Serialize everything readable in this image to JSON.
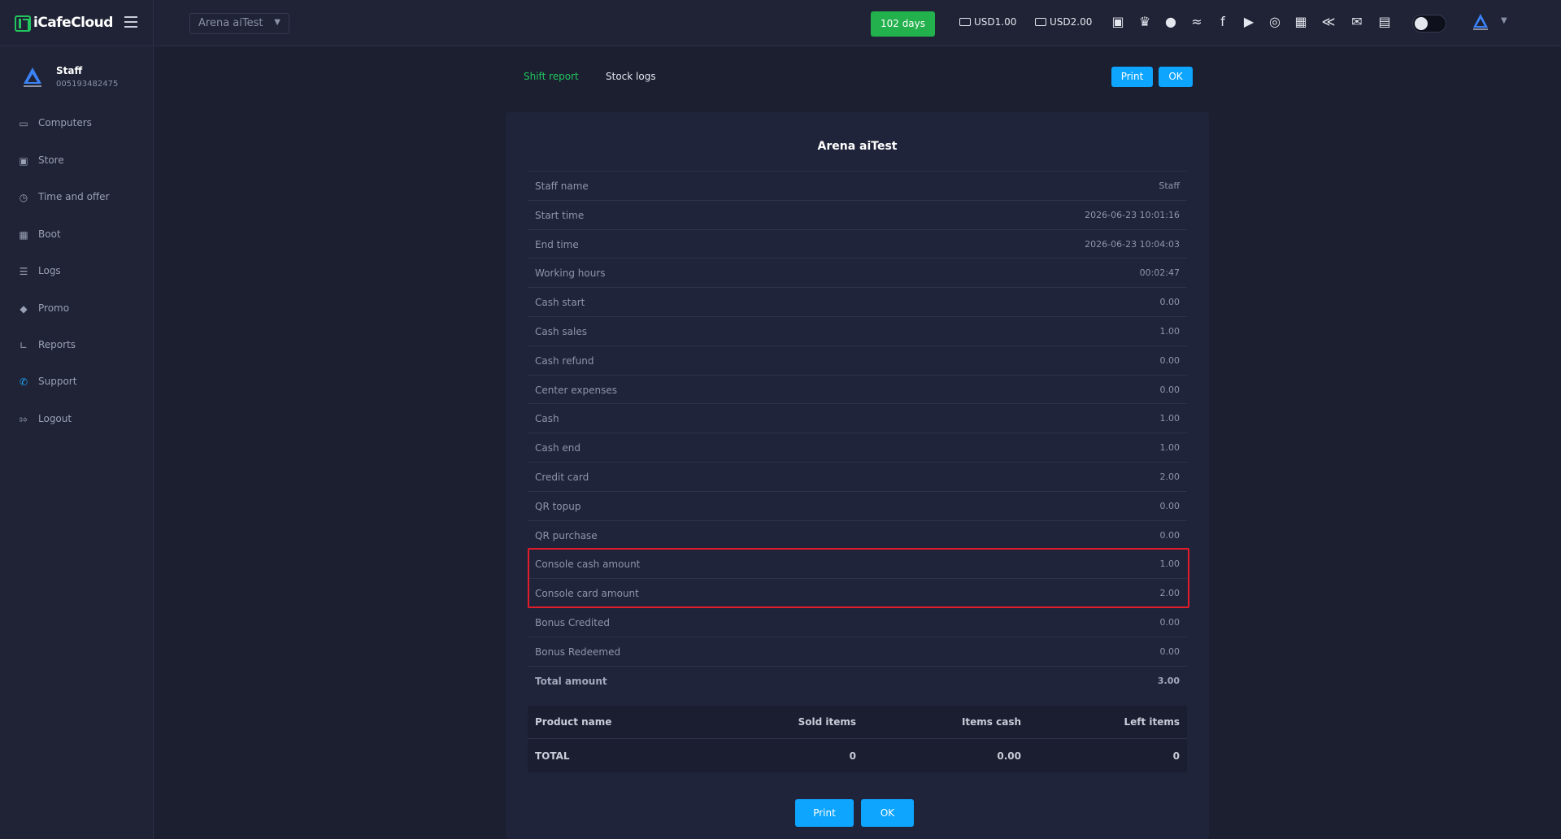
{
  "app": {
    "brand": "iCafeCloud",
    "center": "Arena aiTest",
    "days_left": "102 days",
    "balance_cash": "USD1.00",
    "balance_card": "USD2.00"
  },
  "colors": {
    "accent_green": "#22c55e",
    "button_blue": "#0ea5ff",
    "highlight_red": "#e11d2a",
    "background": "#1b1f30"
  },
  "top_icons": [
    "ranking-icon",
    "trophy-icon",
    "community-icon",
    "rss-icon",
    "facebook-icon",
    "youtube-icon",
    "globe-icon",
    "icafe-icon",
    "handshake-icon",
    "mail-icon",
    "chat-icon"
  ],
  "user": {
    "name": "Staff",
    "id": "005193482475"
  },
  "sidebar": {
    "items": [
      {
        "label": "Computers",
        "icon": "monitor-icon"
      },
      {
        "label": "Store",
        "icon": "bag-icon"
      },
      {
        "label": "Time and offer",
        "icon": "clock-icon"
      },
      {
        "label": "Boot",
        "icon": "windows-icon"
      },
      {
        "label": "Logs",
        "icon": "list-icon"
      },
      {
        "label": "Promo",
        "icon": "tag-icon"
      },
      {
        "label": "Reports",
        "icon": "chart-icon"
      },
      {
        "label": "Support",
        "icon": "phone-icon"
      },
      {
        "label": "Logout",
        "icon": "logout-icon"
      }
    ]
  },
  "tabs": {
    "shift_report": "Shift report",
    "stock_logs": "Stock logs"
  },
  "actions": {
    "print": "Print",
    "ok": "OK"
  },
  "report": {
    "title": "Arena aiTest",
    "rows": [
      {
        "label": "Staff name",
        "value": "Staff"
      },
      {
        "label": "Start time",
        "value": "2026-06-23 10:01:16"
      },
      {
        "label": "End time",
        "value": "2026-06-23 10:04:03"
      },
      {
        "label": "Working hours",
        "value": "00:02:47"
      },
      {
        "label": "Cash start",
        "value": "0.00"
      },
      {
        "label": "Cash sales",
        "value": "1.00"
      },
      {
        "label": "Cash refund",
        "value": "0.00"
      },
      {
        "label": "Center expenses",
        "value": "0.00"
      },
      {
        "label": "Cash",
        "value": "1.00"
      },
      {
        "label": "Cash end",
        "value": "1.00"
      },
      {
        "label": "Credit card",
        "value": "2.00"
      },
      {
        "label": "QR topup",
        "value": "0.00"
      },
      {
        "label": "QR purchase",
        "value": "0.00"
      },
      {
        "label": "Console cash amount",
        "value": "1.00"
      },
      {
        "label": "Console card amount",
        "value": "2.00"
      },
      {
        "label": "Bonus Credited",
        "value": "0.00"
      },
      {
        "label": "Bonus Redeemed",
        "value": "0.00"
      },
      {
        "label": "Total amount",
        "value": "3.00"
      }
    ],
    "products": {
      "headers": [
        "Product name",
        "Sold items",
        "Items cash",
        "Left items"
      ],
      "total": [
        "TOTAL",
        "0",
        "0.00",
        "0"
      ]
    }
  }
}
